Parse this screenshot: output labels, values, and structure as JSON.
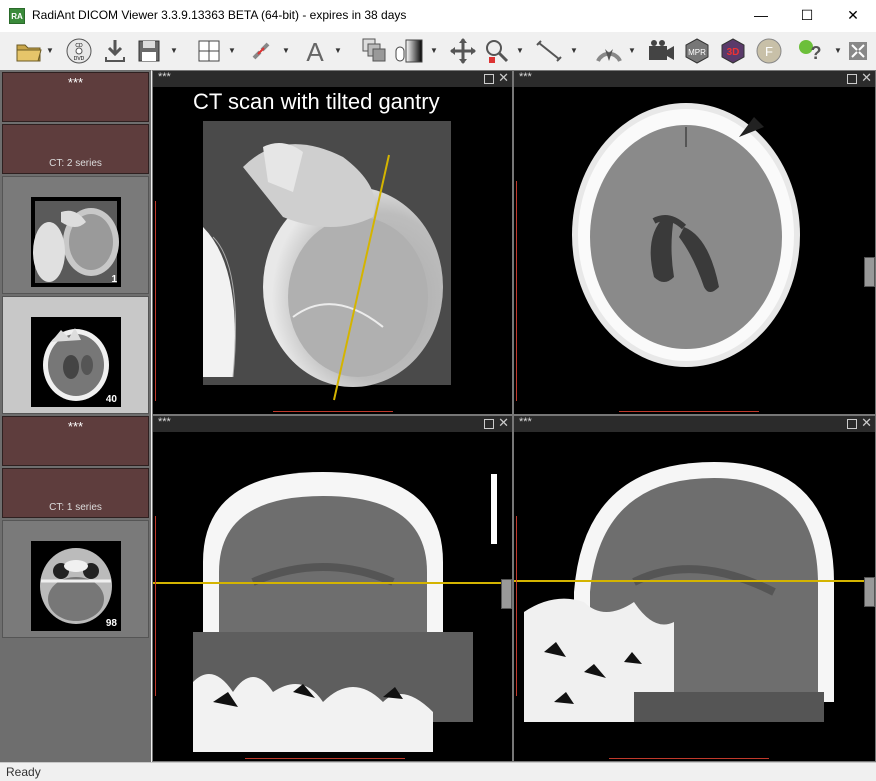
{
  "window": {
    "title": "RadiAnt DICOM Viewer 3.3.9.13363 BETA (64-bit) - expires in 38 days",
    "logo_text": "RA",
    "controls": {
      "minimize": "—",
      "maximize": "☐",
      "close": "✕"
    }
  },
  "toolbar": {
    "buttons": [
      "open-folder-icon",
      "cd-dvd-icon",
      "download-icon",
      "save-icon",
      "layout-grid-icon",
      "link-icon",
      "annotation-text-icon",
      "series-stack-icon",
      "window-level-icon",
      "pan-icon",
      "zoom-icon",
      "measure-icon",
      "cine-icon",
      "export-video-icon",
      "mpr-icon",
      "3d-icon",
      "fusion-icon",
      "help-icon",
      "fullscreen-icon"
    ],
    "labels": {
      "cd": "CD\nDVD",
      "text": "A",
      "mpr": "MPR",
      "three_d": "3D",
      "fusion": "F"
    }
  },
  "sidebar": {
    "studies": [
      {
        "header": "***",
        "info": "CT: 2 series",
        "series": [
          {
            "count": "1",
            "selected": false
          },
          {
            "count": "40",
            "selected": true
          }
        ]
      },
      {
        "header": "***",
        "info": "CT: 1 series",
        "series": [
          {
            "count": "98",
            "selected": false
          }
        ]
      }
    ]
  },
  "viewports": [
    {
      "header": "***",
      "caption": "CT scan with tilted gantry",
      "image": "scout"
    },
    {
      "header": "***",
      "caption": "",
      "image": "axial"
    },
    {
      "header": "***",
      "caption": "",
      "image": "coronal"
    },
    {
      "header": "***",
      "caption": "",
      "image": "sagittal"
    }
  ],
  "colors": {
    "reference_line": "#d4b400",
    "ruler": "#c0392b",
    "study_header": "#5e3d3d"
  },
  "status": {
    "text": "Ready"
  }
}
